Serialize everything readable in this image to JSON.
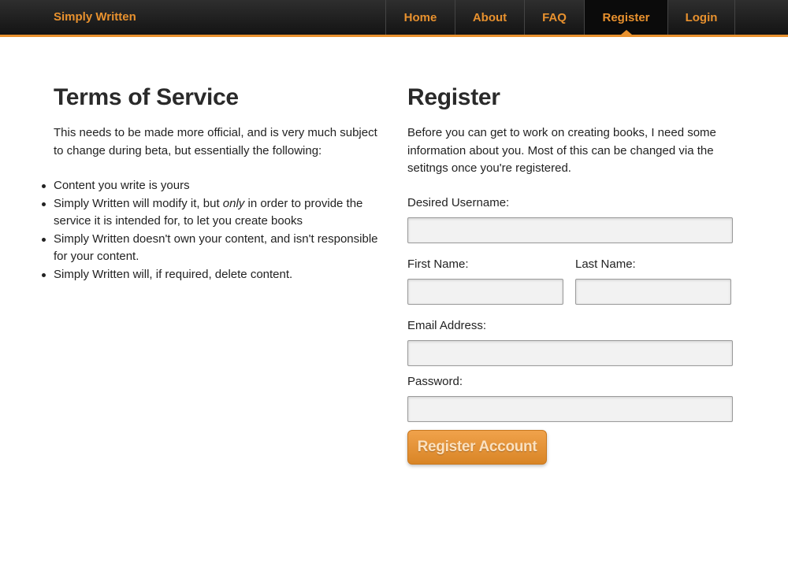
{
  "nav": {
    "brand": "Simply Written",
    "items": [
      {
        "label": "Home",
        "active": false
      },
      {
        "label": "About",
        "active": false
      },
      {
        "label": "FAQ",
        "active": false
      },
      {
        "label": "Register",
        "active": true
      },
      {
        "label": "Login",
        "active": false
      }
    ]
  },
  "terms": {
    "title": "Terms of Service",
    "intro": "This needs to be made more official, and is very much subject to change during beta, but essentially the following:",
    "items": [
      {
        "text": "Content you write is yours"
      },
      {
        "pre": "Simply Written will modify it, but ",
        "em": "only",
        "post": " in order to provide the service it is intended for, to let you create books"
      },
      {
        "text": "Simply Written doesn't own your content, and isn't responsible for your content."
      },
      {
        "text": "Simply Written will, if required, delete content."
      }
    ]
  },
  "register": {
    "title": "Register",
    "intro": "Before you can get to work on creating books, I need some information about you. Most of this can be changed via the setitngs once you're registered.",
    "username_label": "Desired Username:",
    "first_name_label": "First Name:",
    "last_name_label": "Last Name:",
    "email_label": "Email Address:",
    "password_label": "Password:",
    "username_value": "",
    "first_name_value": "",
    "last_name_value": "",
    "email_value": "",
    "password_value": "",
    "submit_label": "Register Account"
  },
  "colors": {
    "accent": "#e8912e",
    "navbar": "#1e1e1e",
    "button": "#e39234"
  }
}
